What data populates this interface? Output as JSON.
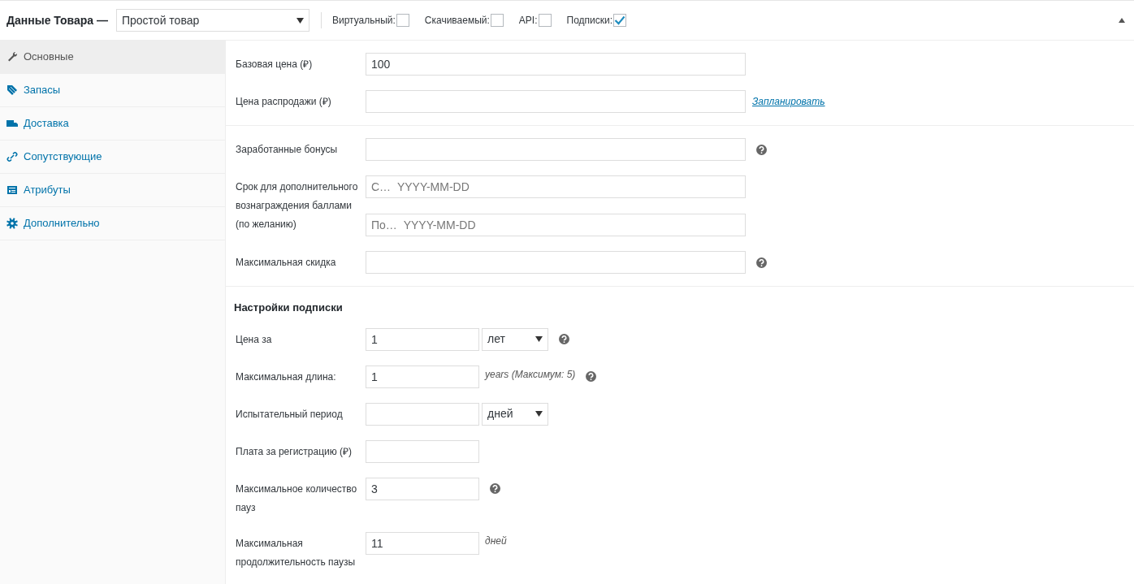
{
  "header": {
    "title": "Данные Товара —",
    "product_type": "Простой товар",
    "options": [
      {
        "label": "Виртуальный:",
        "checked": false
      },
      {
        "label": "Скачиваемый:",
        "checked": false
      },
      {
        "label": "API:",
        "checked": false
      },
      {
        "label": "Подписки:",
        "checked": true
      }
    ]
  },
  "sidebar": {
    "items": [
      {
        "label": "Основные",
        "selected": true
      },
      {
        "label": "Запасы",
        "selected": false
      },
      {
        "label": "Доставка",
        "selected": false
      },
      {
        "label": "Сопутствующие",
        "selected": false
      },
      {
        "label": "Атрибуты",
        "selected": false
      },
      {
        "label": "Дополнительно",
        "selected": false
      }
    ]
  },
  "sections": [
    {
      "kind": "wide",
      "rows": [
        {
          "label": "Базовая цена (₽)",
          "inputs": [
            {
              "kind": "text",
              "value": "100"
            }
          ]
        },
        {
          "label": "Цена распродажи (₽)",
          "inputs": [
            {
              "kind": "text"
            }
          ],
          "link": "Запланировать"
        }
      ]
    },
    {
      "kind": "wide",
      "rows": [
        {
          "label": "Заработанные бонусы",
          "inputs": [
            {
              "kind": "text"
            }
          ],
          "help": true
        },
        {
          "label": "Срок для дополнительного вознаграждения баллами (по желанию)",
          "inputs": [
            {
              "kind": "text",
              "placeholder": "С…  YYYY-MM-DD"
            },
            {
              "kind": "text",
              "placeholder": "По…  YYYY-MM-DD"
            }
          ]
        },
        {
          "label": "Максимальная скидка",
          "inputs": [
            {
              "kind": "text"
            }
          ],
          "help": true
        }
      ]
    },
    {
      "kind": "narrow",
      "heading": "Настройки подписки",
      "rows": [
        {
          "label": "Цена за",
          "inputs": [
            {
              "kind": "text",
              "value": "1"
            }
          ],
          "select": "лет",
          "help": true
        },
        {
          "label": "Максимальная длина:",
          "inputs": [
            {
              "kind": "text",
              "value": "1"
            }
          ],
          "suffix": "years (Максимум: 5)",
          "help": true
        },
        {
          "label": "Испытательный период",
          "inputs": [
            {
              "kind": "text"
            }
          ],
          "select": "дней"
        },
        {
          "label": "Плата за регистрацию (₽)",
          "inputs": [
            {
              "kind": "text"
            }
          ]
        },
        {
          "label": "Максимальное количество пауз",
          "inputs": [
            {
              "kind": "text",
              "value": "3"
            }
          ],
          "help": true
        },
        {
          "label": "Максимальная продолжительность паузы",
          "inputs": [
            {
              "kind": "text",
              "value": "11"
            }
          ],
          "suffix": "дней"
        }
      ]
    }
  ]
}
